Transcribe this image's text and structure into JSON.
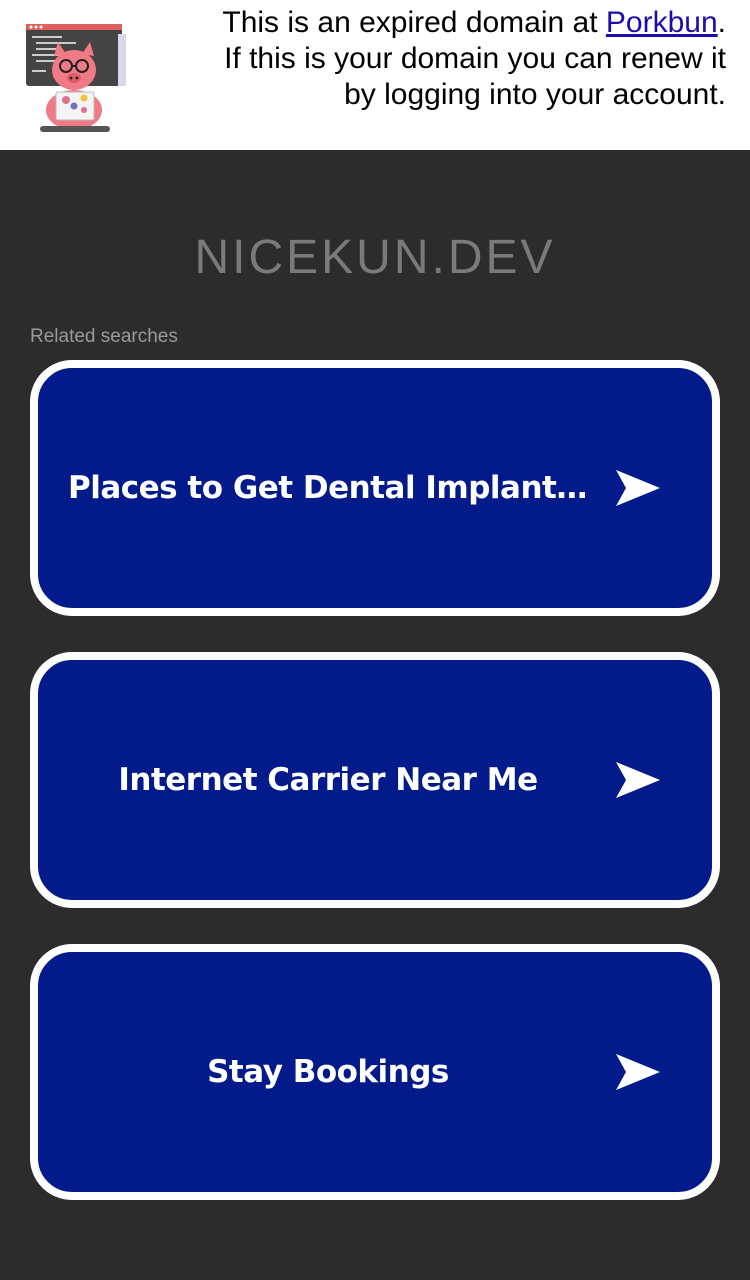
{
  "banner": {
    "text_before": "This is an expired domain at ",
    "link_text": "Porkbun",
    "text_after": ". If this is your domain you can renew it by logging into your account.",
    "logo_icon": "porkbun-pig-logo"
  },
  "domain": {
    "name": "NICEKUN.DEV"
  },
  "related": {
    "label": "Related searches",
    "items": [
      {
        "label": "Places to Get Dental Implants Ne..."
      },
      {
        "label": "Internet Carrier Near Me"
      },
      {
        "label": "Stay Bookings"
      }
    ],
    "arrow_icon": "arrow-right-icon"
  },
  "colors": {
    "background": "#2c2c2c",
    "card_fill": "#021a8a",
    "card_border": "#ffffff",
    "link": "#1a0dab",
    "title": "#7a7a7a"
  }
}
